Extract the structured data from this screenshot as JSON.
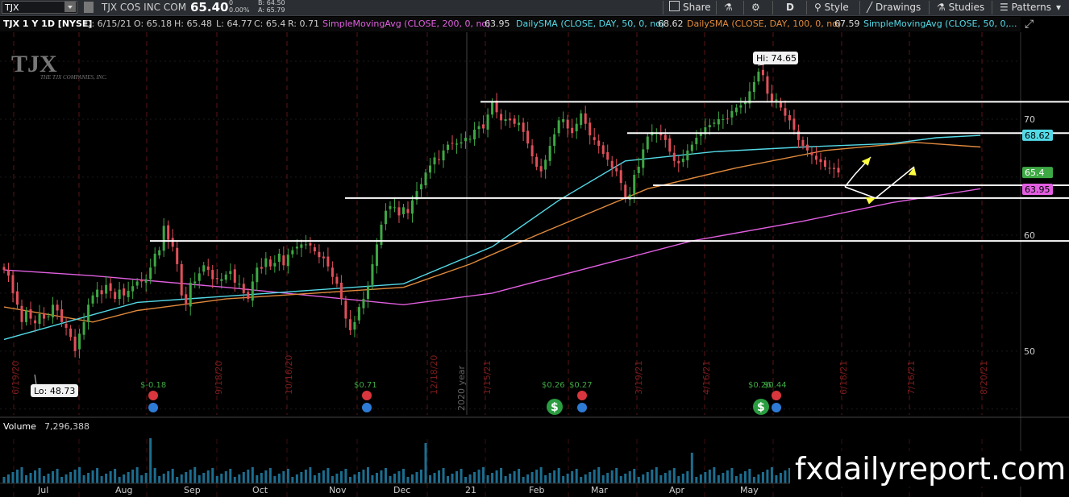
{
  "toolbar": {
    "symbol": "TJX",
    "company": "TJX COS INC COM",
    "last": "65.40",
    "change": "0",
    "change_pct": "0.00%",
    "bid": "B: 64.50",
    "ask": "A: 65.79",
    "share": "Share",
    "timeframe": "D",
    "style": "Style",
    "drawings": "Drawings",
    "studies": "Studies",
    "patterns": "Patterns"
  },
  "header": {
    "title": "TJX 1 Y 1D [NYSE]",
    "date": "D: 6/15/21",
    "open": "O: 65.18",
    "high": "H: 65.48",
    "low": "L: 64.77",
    "close": "C: 65.4",
    "range": "R: 0.71",
    "study1": "SimpleMovingAvg (CLOSE, 200, 0, no)",
    "study1_val": "63.95",
    "study2": "DailySMA (CLOSE, DAY, 50, 0, no)",
    "study2_val": "68.62",
    "study3": "DailySMA (CLOSE, DAY, 100, 0, no)",
    "study3_val": "67.59",
    "study4": "SimpleMovingAvg (CLOSE, 50, 0,..."
  },
  "logo_text": "TJX",
  "logo_sub": "THE TJX COMPANIES, INC.",
  "colors": {
    "up": "#3ea844",
    "down": "#e0505a",
    "sma50": "#53d9e6",
    "sma100": "#e08a3c",
    "sma200": "#e15fe0",
    "bg": "#000000"
  },
  "chart_data": {
    "type": "candlestick",
    "ylim": [
      44.5,
      77.5
    ],
    "yticks": [
      50,
      60,
      70
    ],
    "hi_label": "Hi: 74.65",
    "lo_label": "Lo: 48.73",
    "price_badges": [
      {
        "value": 68.62,
        "label": "68.62",
        "color": "#53d9e6"
      },
      {
        "value": 65.4,
        "label": "65.4",
        "color": "#3ea844"
      },
      {
        "value": 63.95,
        "label": "63.95",
        "color": "#e15fe0"
      }
    ],
    "date_labels": [
      "6/19/20",
      "9/18/20",
      "10/16/20",
      "12/18/20",
      "1/15/21",
      "3/19/21",
      "4/16/21",
      "6/18/21",
      "7/16/21",
      "8/20/21"
    ],
    "year_label": "2020 year",
    "months": [
      "Jul",
      "Aug",
      "Sep",
      "Oct",
      "Nov",
      "Dec",
      "21",
      "Feb",
      "Mar",
      "Apr",
      "May"
    ],
    "dividends": [
      "$-0.18",
      "$0.71",
      "$0.26",
      "$0.27",
      "$0.26",
      "$0.44"
    ],
    "horizontal_levels": [
      71.5,
      68.8,
      64.3,
      63.2,
      59.5
    ],
    "candles_close": [
      57,
      56.5,
      55,
      54,
      52.5,
      53.5,
      52.8,
      52.4,
      53.2,
      52.8,
      53,
      54,
      53.5,
      52.5,
      52,
      51.2,
      50,
      51.5,
      52.5,
      54,
      54.8,
      55.3,
      54.9,
      55.7,
      55.2,
      54.5,
      55.3,
      54.8,
      55.2,
      55.6,
      56,
      56,
      56.2,
      57.2,
      58.4,
      58.7,
      60.8,
      59.6,
      59,
      57.5,
      54.8,
      54,
      55.9,
      56,
      56.7,
      57.4,
      57,
      56.2,
      56.2,
      56.2,
      56.6,
      56.9,
      55.9,
      55.8,
      55,
      54.5,
      56,
      57.2,
      57.1,
      58,
      57.3,
      57.6,
      58.4,
      57.4,
      58.3,
      58.7,
      59,
      59.2,
      59.2,
      59.1,
      58.6,
      58.1,
      58,
      57.3,
      56.4,
      55.8,
      54.5,
      52.8,
      51.8,
      52.5,
      53.8,
      54.5,
      55.6,
      57.5,
      59.2,
      60.9,
      62.1,
      62.5,
      62.4,
      61.7,
      62.4,
      61.9,
      63,
      63.8,
      64.4,
      65.4,
      66,
      66.7,
      66.5,
      67.3,
      67.8,
      67.9,
      67.9,
      68,
      68.4,
      68.3,
      69.1,
      69.4,
      69.2,
      70.4,
      71.5,
      70.6,
      69.9,
      70,
      69.9,
      69.6,
      69.7,
      68.9,
      67.9,
      66.8,
      65.9,
      65.5,
      66.5,
      67.7,
      68.7,
      69.9,
      70,
      69.2,
      68.8,
      69.6,
      70.5,
      69.6,
      68.6,
      68.2,
      67.7,
      67,
      66.5,
      65.8,
      65.5,
      64.5,
      63.1,
      63.5,
      65.2,
      65.9,
      67.4,
      68.5,
      68.9,
      68.8,
      68.6,
      68.2,
      67.2,
      66.4,
      66.2,
      66.6,
      67.3,
      67.8,
      68.4,
      68.8,
      69.3,
      69.5,
      69.7,
      70,
      70,
      70,
      70.7,
      71,
      71.2,
      71.5,
      72.4,
      73.2,
      74.1,
      73.8,
      72.2,
      71.5,
      71.7,
      71,
      70.3,
      69.9,
      69.1,
      68.2,
      67.7,
      67.3,
      66.9,
      66.5,
      66.3,
      65.9,
      65.8,
      65.7,
      65.4
    ],
    "sma50": [
      [
        0,
        51
      ],
      [
        30,
        54.2
      ],
      [
        60,
        55
      ],
      [
        90,
        55.8
      ],
      [
        110,
        59
      ],
      [
        125,
        63
      ],
      [
        140,
        66.4
      ],
      [
        160,
        67.2
      ],
      [
        180,
        67.6
      ],
      [
        200,
        67.9
      ],
      [
        210,
        68.4
      ],
      [
        220,
        68.6
      ]
    ],
    "sma100": [
      [
        0,
        53.8
      ],
      [
        20,
        52.5
      ],
      [
        30,
        53.5
      ],
      [
        50,
        54.5
      ],
      [
        70,
        55
      ],
      [
        90,
        55.5
      ],
      [
        105,
        57.5
      ],
      [
        120,
        60
      ],
      [
        145,
        64
      ],
      [
        165,
        65.8
      ],
      [
        185,
        67.3
      ],
      [
        205,
        68
      ],
      [
        220,
        67.6
      ]
    ],
    "sma200": [
      [
        0,
        57
      ],
      [
        20,
        56.5
      ],
      [
        50,
        55.5
      ],
      [
        90,
        54
      ],
      [
        110,
        55
      ],
      [
        130,
        57
      ],
      [
        155,
        59.5
      ],
      [
        180,
        61.2
      ],
      [
        200,
        62.8
      ],
      [
        220,
        64
      ]
    ]
  },
  "volume": {
    "label": "Volume",
    "value": "7,296,388"
  },
  "watermark": "fxdailyreport.com"
}
